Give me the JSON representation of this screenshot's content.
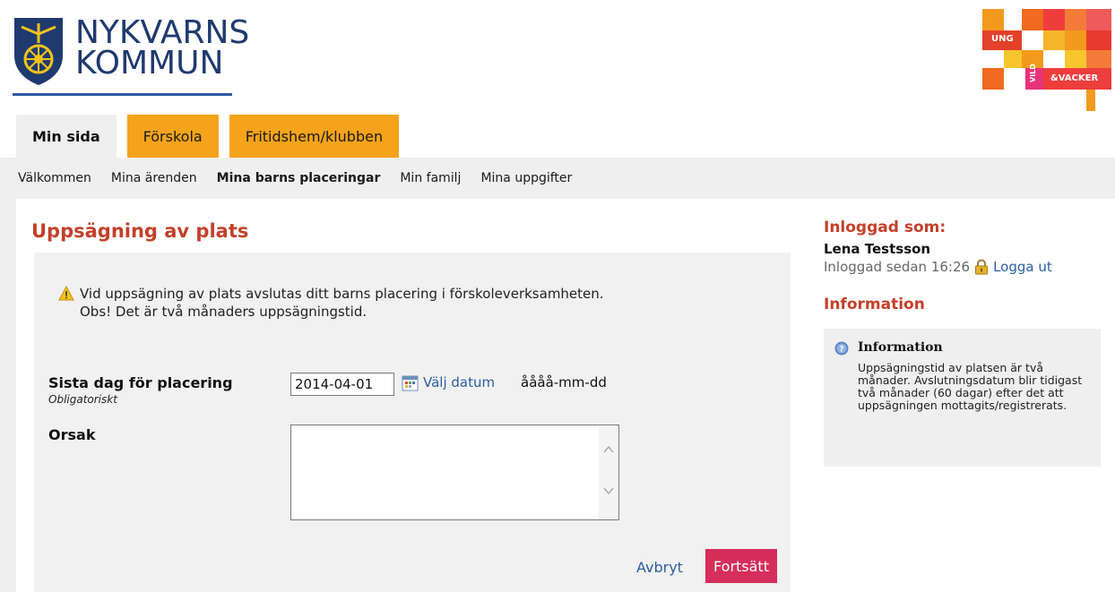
{
  "header": {
    "logo_line1": "NYKVARNS",
    "logo_line2": "KOMMUN",
    "brand_ung": "UNG",
    "brand_vild": "VILD",
    "brand_vacker": "&VACKER"
  },
  "tabs": [
    {
      "label": "Min sida",
      "active": true
    },
    {
      "label": "Förskola",
      "active": false
    },
    {
      "label": "Fritidshem/klubben",
      "active": false
    }
  ],
  "subnav": [
    {
      "label": "Välkommen",
      "active": false
    },
    {
      "label": "Mina ärenden",
      "active": false
    },
    {
      "label": "Mina barns placeringar",
      "active": true
    },
    {
      "label": "Min familj",
      "active": false
    },
    {
      "label": "Mina uppgifter",
      "active": false
    }
  ],
  "main": {
    "title": "Uppsägning av plats",
    "notice_line1": "Vid uppsägning av plats avslutas ditt barns placering i förskoleverksamheten.",
    "notice_line2": "Obs! Det är två månaders uppsägningstid.",
    "last_day_label": "Sista dag för placering",
    "required_label": "Obligatoriskt",
    "date_value": "2014-04-01",
    "choose_date": "Välj datum",
    "date_format": "åååå-mm-dd",
    "reason_label": "Orsak",
    "reason_value": "",
    "cancel_label": "Avbryt",
    "continue_label": "Fortsätt"
  },
  "sidebar": {
    "logged_in_heading": "Inloggad som:",
    "user_name": "Lena Testsson",
    "logged_in_since": "Inloggad sedan 16:26",
    "logout_label": "Logga ut",
    "info_heading": "Information",
    "info_box_title": "Information",
    "info_box_text": "Uppsägningstid av platsen är två månader. Avslutningsdatum blir tidigast två månader (60 dagar) efter det att uppsägningen mottagits/registrerats."
  },
  "colors": {
    "accent_red": "#c3402a",
    "tab_orange": "#f5a31a",
    "button_pink": "#d62e5a",
    "link_blue": "#2b5fa3",
    "logo_blue": "#1f3a6e"
  }
}
